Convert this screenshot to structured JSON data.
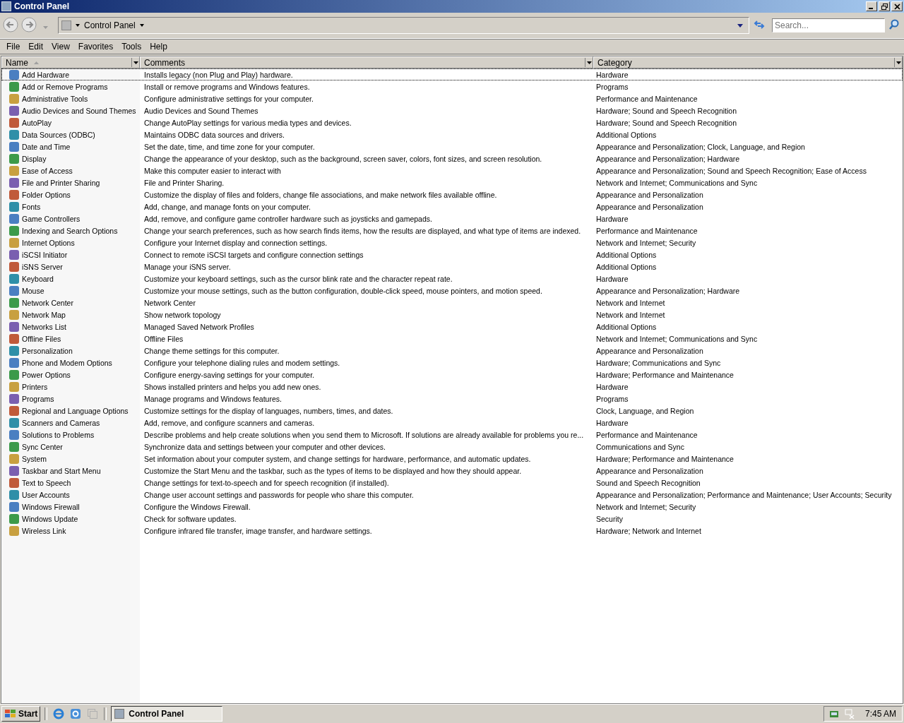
{
  "window": {
    "title": "Control Panel"
  },
  "address_bar": {
    "location": "Control Panel",
    "search_placeholder": "Search..."
  },
  "menu": [
    "File",
    "Edit",
    "View",
    "Favorites",
    "Tools",
    "Help"
  ],
  "table": {
    "columns": [
      {
        "label": "Name",
        "sorted": true
      },
      {
        "label": "Comments",
        "sorted": false
      },
      {
        "label": "Category",
        "sorted": false
      }
    ],
    "rows": [
      {
        "name": "Add Hardware",
        "comments": "Installs legacy (non Plug and Play) hardware.",
        "category": "Hardware",
        "focused": true
      },
      {
        "name": "Add or Remove Programs",
        "comments": "Install or remove programs and Windows features.",
        "category": "Programs",
        "focused": false
      },
      {
        "name": "Administrative Tools",
        "comments": "Configure administrative settings for your computer.",
        "category": "Performance and Maintenance",
        "focused": false
      },
      {
        "name": "Audio Devices and Sound Themes",
        "comments": "Audio Devices and Sound Themes",
        "category": "Hardware; Sound and Speech Recognition",
        "focused": false
      },
      {
        "name": "AutoPlay",
        "comments": "Change AutoPlay settings for various media types and devices.",
        "category": "Hardware; Sound and Speech Recognition",
        "focused": false
      },
      {
        "name": "Data Sources (ODBC)",
        "comments": "Maintains ODBC data sources and drivers.",
        "category": "Additional Options",
        "focused": false
      },
      {
        "name": "Date and Time",
        "comments": "Set the date, time, and time zone for your computer.",
        "category": "Appearance and Personalization; Clock, Language, and Region",
        "focused": false
      },
      {
        "name": "Display",
        "comments": "Change the appearance of your desktop, such as the background, screen saver, colors, font sizes, and screen resolution.",
        "category": "Appearance and Personalization; Hardware",
        "focused": false
      },
      {
        "name": "Ease of Access",
        "comments": "Make this computer easier to interact with",
        "category": "Appearance and Personalization; Sound and Speech Recognition; Ease of Access",
        "focused": false
      },
      {
        "name": "File and Printer Sharing",
        "comments": "File and Printer Sharing.",
        "category": "Network and Internet; Communications and Sync",
        "focused": false
      },
      {
        "name": "Folder Options",
        "comments": "Customize the display of files and folders, change file associations, and make network files available offline.",
        "category": "Appearance and Personalization",
        "focused": false
      },
      {
        "name": "Fonts",
        "comments": "Add, change, and manage fonts on your computer.",
        "category": "Appearance and Personalization",
        "focused": false
      },
      {
        "name": "Game Controllers",
        "comments": "Add, remove, and configure game controller hardware such as joysticks and gamepads.",
        "category": "Hardware",
        "focused": false
      },
      {
        "name": "Indexing and Search Options",
        "comments": "Change your search preferences, such as how search finds items, how the results are displayed, and what type of items are indexed.",
        "category": "Performance and Maintenance",
        "focused": false
      },
      {
        "name": "Internet Options",
        "comments": "Configure your Internet display and connection settings.",
        "category": "Network and Internet; Security",
        "focused": false
      },
      {
        "name": "iSCSI Initiator",
        "comments": "Connect to remote iSCSI targets and configure connection settings",
        "category": "Additional Options",
        "focused": false
      },
      {
        "name": "iSNS Server",
        "comments": "Manage your iSNS server.",
        "category": "Additional Options",
        "focused": false
      },
      {
        "name": "Keyboard",
        "comments": "Customize your keyboard settings, such as the cursor blink rate and the character repeat rate.",
        "category": "Hardware",
        "focused": false
      },
      {
        "name": "Mouse",
        "comments": "Customize your mouse settings, such as the button configuration, double-click speed, mouse pointers, and motion speed.",
        "category": "Appearance and Personalization; Hardware",
        "focused": false
      },
      {
        "name": "Network Center",
        "comments": "Network Center",
        "category": "Network and Internet",
        "focused": false
      },
      {
        "name": "Network Map",
        "comments": "Show network topology",
        "category": "Network and Internet",
        "focused": false
      },
      {
        "name": "Networks List",
        "comments": "Managed Saved Network Profiles",
        "category": "Additional Options",
        "focused": false
      },
      {
        "name": "Offline Files",
        "comments": "Offline Files",
        "category": "Network and Internet; Communications and Sync",
        "focused": false
      },
      {
        "name": "Personalization",
        "comments": "Change theme settings for this computer.",
        "category": "Appearance and Personalization",
        "focused": false
      },
      {
        "name": "Phone and Modem Options",
        "comments": "Configure your telephone dialing rules and modem settings.",
        "category": "Hardware; Communications and Sync",
        "focused": false
      },
      {
        "name": "Power Options",
        "comments": "Configure energy-saving settings for your computer.",
        "category": "Hardware; Performance and Maintenance",
        "focused": false
      },
      {
        "name": "Printers",
        "comments": "Shows installed printers and helps you add new ones.",
        "category": "Hardware",
        "focused": false
      },
      {
        "name": "Programs",
        "comments": "Manage programs and Windows features.",
        "category": "Programs",
        "focused": false
      },
      {
        "name": "Regional and Language Options",
        "comments": "Customize settings for the display of languages, numbers, times, and dates.",
        "category": "Clock, Language, and Region",
        "focused": false
      },
      {
        "name": "Scanners and Cameras",
        "comments": "Add, remove, and configure scanners and cameras.",
        "category": "Hardware",
        "focused": false
      },
      {
        "name": "Solutions to Problems",
        "comments": "Describe problems and help create solutions when you send them to Microsoft. If solutions are already available for problems you re...",
        "category": "Performance and Maintenance",
        "focused": false
      },
      {
        "name": "Sync Center",
        "comments": "Synchronize data and settings between your computer and other devices.",
        "category": "Communications and Sync",
        "focused": false
      },
      {
        "name": "System",
        "comments": "Set information about your computer system, and change settings for hardware, performance, and automatic updates.",
        "category": "Hardware; Performance and Maintenance",
        "focused": false
      },
      {
        "name": "Taskbar and Start Menu",
        "comments": "Customize the Start Menu and the taskbar, such as the types of items to be displayed and how they should appear.",
        "category": "Appearance and Personalization",
        "focused": false
      },
      {
        "name": "Text to Speech",
        "comments": "Change settings for text-to-speech and for speech recognition (if installed).",
        "category": "Sound and Speech Recognition",
        "focused": false
      },
      {
        "name": "User Accounts",
        "comments": "Change user account settings and passwords for people who share this computer.",
        "category": "Appearance and Personalization; Performance and Maintenance; User Accounts; Security",
        "focused": false
      },
      {
        "name": "Windows Firewall",
        "comments": "Configure the Windows Firewall.",
        "category": "Network and Internet; Security",
        "focused": false
      },
      {
        "name": "Windows Update",
        "comments": "Check for software updates.",
        "category": "Security",
        "focused": false
      },
      {
        "name": "Wireless Link",
        "comments": "Configure infrared file transfer, image transfer, and hardware settings.",
        "category": "Hardware; Network and Internet",
        "focused": false
      }
    ]
  },
  "taskbar": {
    "start": "Start",
    "tasks": [
      {
        "label": "Control Panel",
        "selected": true
      }
    ],
    "clock": "7:45 AM"
  }
}
